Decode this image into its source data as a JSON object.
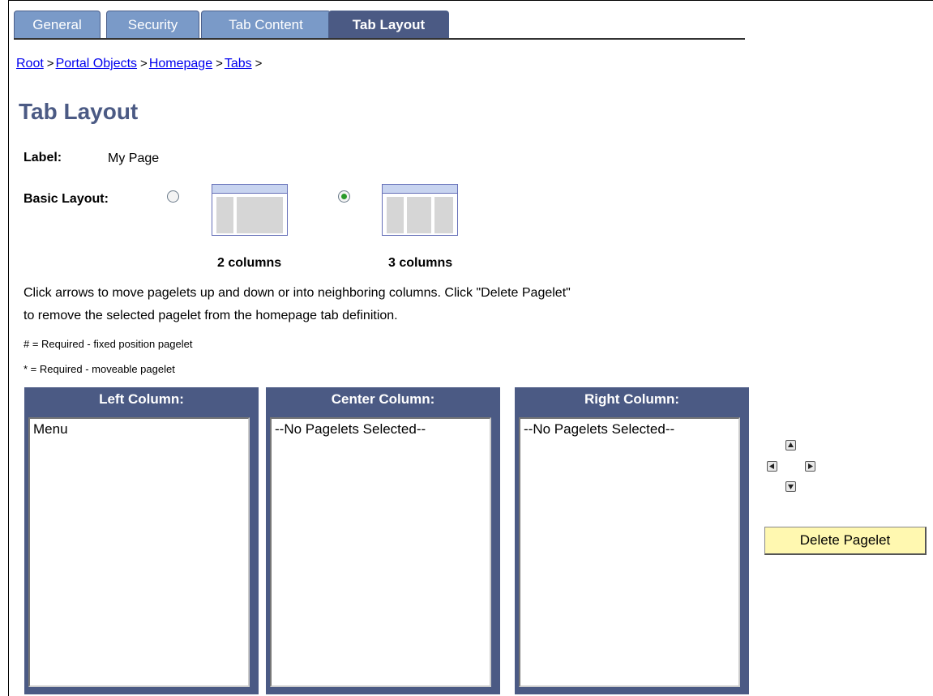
{
  "tabs": [
    {
      "label": "General",
      "active": false
    },
    {
      "label": "Security",
      "active": false
    },
    {
      "label": "Tab Content",
      "active": false
    },
    {
      "label": "Tab Layout",
      "active": true
    }
  ],
  "breadcrumb": {
    "items": [
      "Root",
      "Portal Objects",
      "Homepage",
      "Tabs"
    ],
    "separator": ">"
  },
  "page": {
    "title": "Tab Layout",
    "label_caption": "Label:",
    "label_value": "My Page",
    "basic_layout_caption": "Basic Layout:",
    "layout_options": [
      {
        "caption": "2 columns",
        "selected": false,
        "icon": "two-column-layout-icon"
      },
      {
        "caption": "3 columns",
        "selected": true,
        "icon": "three-column-layout-icon"
      }
    ],
    "instructions_line1": "Click arrows to move pagelets up and down or into neighboring columns. Click \"Delete Pagelet\"",
    "instructions_line2": "to remove the selected pagelet from the homepage tab definition.",
    "legend_required_fixed": "# = Required - fixed position pagelet",
    "legend_required_moveable": "* = Required - moveable pagelet"
  },
  "columns": [
    {
      "header": "Left Column:",
      "items": [
        "Menu"
      ]
    },
    {
      "header": "Center Column:",
      "items": [
        "--No Pagelets Selected--"
      ]
    },
    {
      "header": "Right Column:",
      "items": [
        "--No Pagelets Selected--"
      ]
    }
  ],
  "arrows": [
    "arrow-up-icon",
    "arrow-left-icon",
    "arrow-right-icon",
    "arrow-down-icon"
  ],
  "delete_button": "Delete Pagelet",
  "colors": {
    "tab": "#7a9ac8",
    "tab_active": "#4b5a84",
    "column_header": "#4b5a84",
    "title": "#4b5a84",
    "delete_button": "#fff8b0",
    "link": "#0000ee"
  }
}
